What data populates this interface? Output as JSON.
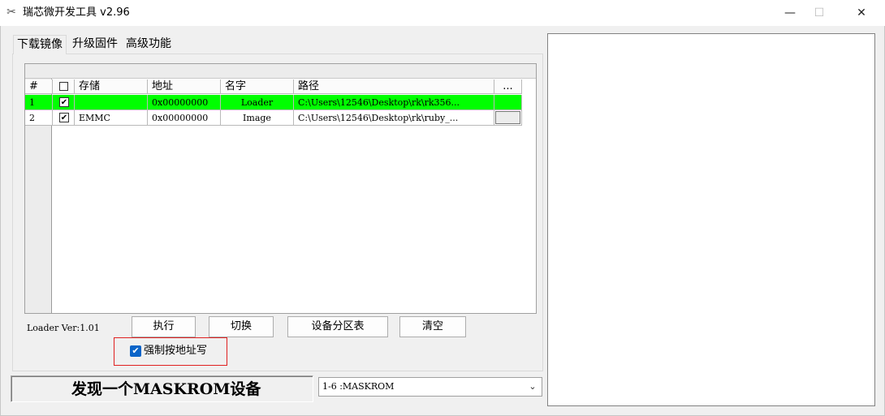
{
  "window": {
    "title": "瑞芯微开发工具 v2.96",
    "icon": "tools-icon",
    "controls": {
      "minimize": "—",
      "maximize": "☐",
      "close": "✕"
    }
  },
  "tabs": [
    {
      "label": "下载镜像",
      "active": true
    },
    {
      "label": "升级固件",
      "active": false
    },
    {
      "label": "高级功能",
      "active": false
    }
  ],
  "grid": {
    "headers": [
      "#",
      "",
      "存储",
      "地址",
      "名字",
      "路径",
      "..."
    ],
    "rows": [
      {
        "num": "1",
        "checked": true,
        "storage": "",
        "address": "0x00000000",
        "name": "Loader",
        "path": "C:\\Users\\12546\\Desktop\\rk\\rk356...",
        "selected": true
      },
      {
        "num": "2",
        "checked": true,
        "storage": "EMMC",
        "address": "0x00000000",
        "name": "Image",
        "path": "C:\\Users\\12546\\Desktop\\rk\\ruby_...",
        "selected": false
      }
    ]
  },
  "loader_version": "Loader Ver:1.01",
  "buttons": {
    "execute": "执行",
    "switch": "切换",
    "partition_table": "设备分区表",
    "clear": "清空"
  },
  "force_write": {
    "label": "强制按地址写",
    "checked": true
  },
  "status": {
    "text": "发现一个MASKROM设备"
  },
  "device_select": {
    "selected": "1-6 :MASKROM"
  },
  "colors": {
    "selected_row": "#00ff00",
    "highlight_box": "#e02020",
    "checkbox_accent": "#0a64c8"
  }
}
